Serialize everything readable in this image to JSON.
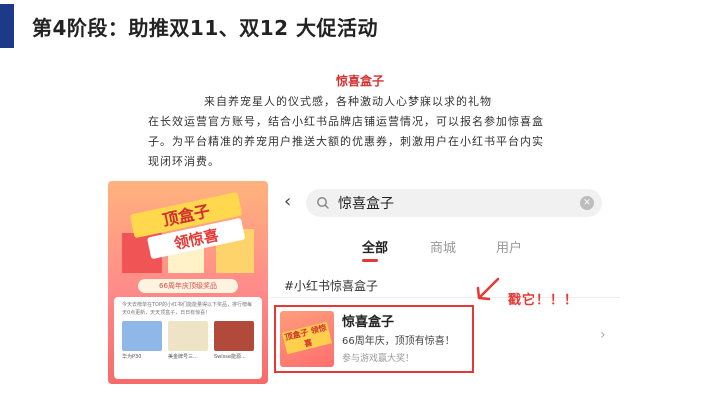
{
  "slide": {
    "title": "第4阶段：助推双11、双12 大促活动"
  },
  "intro": {
    "heading": "惊喜盒子",
    "lines": [
      "来自养宠星人的仪式感，各种激动人心梦寐以求的礼物",
      "在长效运营官方账号，结合小红书品牌店铺运营情况，可以报名参加惊喜盒",
      "子。为平台精准的养宠用户推送大额的优惠券，刺激用户在小红书平台内实",
      "现闭环消费。"
    ]
  },
  "promo": {
    "banner_lines": [
      "顶盒子",
      "领惊喜"
    ],
    "ribbon": "66周年庆顶级奖品",
    "text": "今天去榜单在TOP的小红书们能能量得以下奖品，排行榜每天0点更新，天天顶盒子，日日有惊喜！",
    "products": [
      {
        "label": "华为P30",
        "color": "#8fb7e8"
      },
      {
        "label": "美金牌号三...",
        "color": "#efe3c6"
      },
      {
        "label": "Swisse能源...",
        "color": "#b14a3a"
      }
    ]
  },
  "search": {
    "query": "惊喜盒子",
    "tabs": [
      {
        "label": "全部",
        "active": true
      },
      {
        "label": "商城",
        "active": false
      },
      {
        "label": "用户",
        "active": false
      }
    ],
    "topic": "#小红书惊喜盒子",
    "result": {
      "thumb_text": "顶盒子 领惊喜",
      "title": "惊喜盒子",
      "subtitle": "66周年庆，顶顶有惊喜！",
      "meta": "参与游戏赢大奖！"
    }
  },
  "callout": {
    "text": "戳它！！！",
    "color": "#e53935"
  }
}
